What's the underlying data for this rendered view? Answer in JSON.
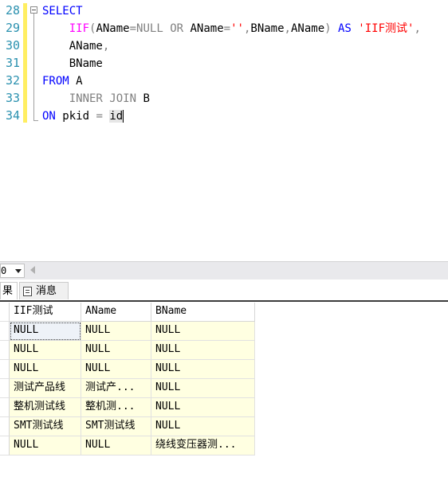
{
  "editor": {
    "lines": [
      {
        "num": "28",
        "tokens": [
          {
            "t": "SELECT",
            "c": "kw"
          }
        ]
      },
      {
        "num": "29",
        "tokens": [
          {
            "t": "    ",
            "c": "plain"
          },
          {
            "t": "IIF",
            "c": "fn"
          },
          {
            "t": "(",
            "c": "gray"
          },
          {
            "t": "AName",
            "c": "plain"
          },
          {
            "t": "=",
            "c": "gray"
          },
          {
            "t": "NULL ",
            "c": "gray"
          },
          {
            "t": "OR ",
            "c": "gray"
          },
          {
            "t": "AName",
            "c": "plain"
          },
          {
            "t": "=",
            "c": "gray"
          },
          {
            "t": "''",
            "c": "str"
          },
          {
            "t": ",",
            "c": "gray"
          },
          {
            "t": "BName",
            "c": "plain"
          },
          {
            "t": ",",
            "c": "gray"
          },
          {
            "t": "AName",
            "c": "plain"
          },
          {
            "t": ") ",
            "c": "gray"
          },
          {
            "t": "AS ",
            "c": "kw"
          },
          {
            "t": "'IIF测试'",
            "c": "str"
          },
          {
            "t": ",",
            "c": "gray"
          }
        ]
      },
      {
        "num": "30",
        "tokens": [
          {
            "t": "    AName",
            "c": "plain"
          },
          {
            "t": ",",
            "c": "gray"
          }
        ]
      },
      {
        "num": "31",
        "tokens": [
          {
            "t": "    BName",
            "c": "plain"
          }
        ]
      },
      {
        "num": "32",
        "tokens": [
          {
            "t": "FROM ",
            "c": "kw"
          },
          {
            "t": "A",
            "c": "plain"
          }
        ]
      },
      {
        "num": "33",
        "tokens": [
          {
            "t": "    ",
            "c": "plain"
          },
          {
            "t": "INNER JOIN ",
            "c": "gray"
          },
          {
            "t": "B",
            "c": "plain"
          }
        ]
      },
      {
        "num": "34",
        "tokens": [
          {
            "t": "ON ",
            "c": "kw"
          },
          {
            "t": "pkid ",
            "c": "plain"
          },
          {
            "t": "= ",
            "c": "gray"
          },
          {
            "t": "id",
            "c": "plain hl"
          }
        ]
      }
    ]
  },
  "zoom": {
    "value": "0"
  },
  "tabs": {
    "results": "果",
    "messages": "消息"
  },
  "grid": {
    "columns": [
      "IIF测试",
      "AName",
      "BName"
    ],
    "rows": [
      [
        "NULL",
        "NULL",
        "NULL"
      ],
      [
        "NULL",
        "NULL",
        "NULL"
      ],
      [
        "NULL",
        "NULL",
        "NULL"
      ],
      [
        "测试产品线",
        "测试产...",
        "NULL"
      ],
      [
        "整机测试线",
        "整机测...",
        "NULL"
      ],
      [
        "SMT测试线",
        "SMT测试线",
        "NULL"
      ],
      [
        "NULL",
        "NULL",
        "绕线变压器测..."
      ]
    ]
  },
  "colors": {
    "keyword": "#0000ff",
    "function": "#ff00ff",
    "string": "#ff0000",
    "operator": "#808080",
    "line_number": "#2b91af",
    "cell_highlight": "#ffffe1",
    "change_bar": "#ffee62"
  }
}
